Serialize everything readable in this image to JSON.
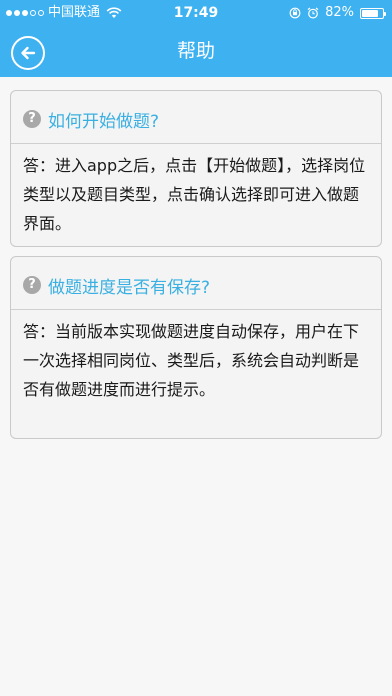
{
  "status_bar": {
    "carrier": "中国联通",
    "time": "17:49",
    "battery_percent_text": "82%",
    "battery_level": 0.82,
    "signal_bars_filled": 3,
    "signal_bars_total": 5
  },
  "header": {
    "title": "帮助",
    "back_icon": "back-arrow-icon"
  },
  "faqs": [
    {
      "question": "如何开始做题?",
      "answer": "答：进入app之后，点击【开始做题】，选择岗位类型以及题目类型，点击确认选择即可进入做题界面。"
    },
    {
      "question": "做题进度是否有保存?",
      "answer": "答：当前版本实现做题进度自动保存，用户在下一次选择相同岗位、类型后，系统会自动判断是否有做题进度而进行提示。"
    }
  ],
  "colors": {
    "header_bg": "#3eb1f0",
    "question_text": "#3ab0e2",
    "page_bg": "#f7f7f7",
    "card_bg": "#f4f4f4",
    "card_border": "#c9c9c9"
  }
}
